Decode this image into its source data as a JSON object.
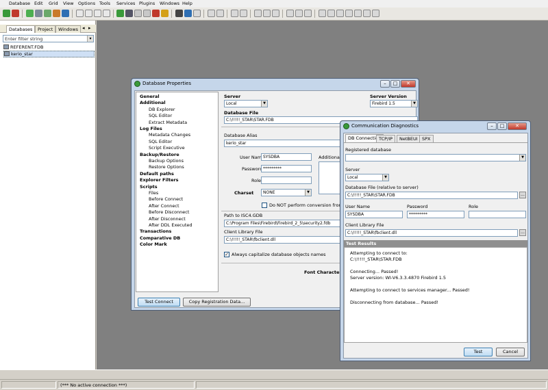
{
  "menu": [
    "Database",
    "Edit",
    "Grid",
    "View",
    "Options",
    "Tools",
    "Services",
    "Plugins",
    "Windows",
    "Help"
  ],
  "left_panel": {
    "tabs": [
      "Databases",
      "Project",
      "Windows"
    ],
    "filter_placeholder": "Enter filter string",
    "tree": [
      "REFERENT.FDB",
      "kerio_star"
    ]
  },
  "status": {
    "connection": "(*** No active connection ***)"
  },
  "db_props": {
    "title": "Database Properties",
    "nav": [
      {
        "label": "General",
        "bold": true,
        "indent": 0
      },
      {
        "label": "Additional",
        "bold": true,
        "indent": 0
      },
      {
        "label": "DB Explorer",
        "bold": false,
        "indent": 1
      },
      {
        "label": "SQL Editor",
        "bold": false,
        "indent": 1
      },
      {
        "label": "Extract Metadata",
        "bold": false,
        "indent": 1
      },
      {
        "label": "Log Files",
        "bold": true,
        "indent": 0
      },
      {
        "label": "Metadata Changes",
        "bold": false,
        "indent": 1
      },
      {
        "label": "SQL Editor",
        "bold": false,
        "indent": 1
      },
      {
        "label": "Script Executive",
        "bold": false,
        "indent": 1
      },
      {
        "label": "Backup/Restore",
        "bold": true,
        "indent": 0
      },
      {
        "label": "Backup Options",
        "bold": false,
        "indent": 1
      },
      {
        "label": "Restore Options",
        "bold": false,
        "indent": 1
      },
      {
        "label": "Default paths",
        "bold": true,
        "indent": 0
      },
      {
        "label": "Explorer Filters",
        "bold": true,
        "indent": 0
      },
      {
        "label": "Scripts",
        "bold": true,
        "indent": 0
      },
      {
        "label": "Files",
        "bold": false,
        "indent": 1
      },
      {
        "label": "Before Connect",
        "bold": false,
        "indent": 1
      },
      {
        "label": "After Connect",
        "bold": false,
        "indent": 1
      },
      {
        "label": "Before Disconnect",
        "bold": false,
        "indent": 1
      },
      {
        "label": "After Disconnect",
        "bold": false,
        "indent": 1
      },
      {
        "label": "After DDL Executed",
        "bold": false,
        "indent": 1
      },
      {
        "label": "Transactions",
        "bold": true,
        "indent": 0
      },
      {
        "label": "Comparative DB",
        "bold": true,
        "indent": 0
      },
      {
        "label": "Color Mark",
        "bold": true,
        "indent": 0
      }
    ],
    "server_label": "Server",
    "server_value": "Local",
    "server_version_label": "Server Version",
    "server_version_value": "Firebird 1.5",
    "db_file_label": "Database File",
    "db_file_value": "C:\\!!!!!_STAR\\STAR.FDB",
    "alias_label": "Database Alias",
    "alias_value": "kerio_star",
    "user_label": "User Name",
    "user_value": "SYSDBA",
    "password_label": "Password",
    "password_value": "*********",
    "role_label": "Role",
    "role_value": "",
    "additional_label": "Additional c",
    "charset_label": "Charset",
    "charset_value": "NONE",
    "noconv_label": "Do NOT perform conversion from/to U",
    "isc4_label": "Path to ISC4.GDB",
    "isc4_value": "C:\\Program Files\\Firebird\\Firebird_2_5\\security2.fdb",
    "client_lib_label": "Client Library File",
    "client_lib_value": "C:\\!!!!!_STAR\\fbclient.dll",
    "capitalize_label": "Always capitalize database objects names",
    "font_chars_label": "Font Characters",
    "test_connect": "Test Connect",
    "copy_reg": "Copy Registration Data..."
  },
  "comm_diag": {
    "title": "Communication Diagnostics",
    "tabs": [
      "DB Connection",
      "TCP/IP",
      "NetBEUI",
      "SPX"
    ],
    "registered_label": "Registered database",
    "registered_value": "",
    "server_label": "Server",
    "server_value": "Local",
    "db_file_label": "Database File (relative to server)",
    "db_file_value": "C:\\!!!!!_STAR\\STAR.FDB",
    "user_label": "User Name",
    "user_value": "SYSDBA",
    "password_label": "Password",
    "password_value": "*********",
    "role_label": "Role",
    "role_value": "",
    "client_lib_label": "Client Library File",
    "client_lib_value": "C:\\!!!!!_STAR\\fbclient.dll",
    "results_header": "Test Results",
    "results": [
      "Attempting to connect to:",
      "C:\\!!!!!_STAR\\STAR.FDB",
      "",
      "Connecting... Passed!",
      "Server version: WI-V6.3.3.4870 Firebird 1.5",
      "",
      "Attempting to connect to services manager... Passed!",
      "",
      "Disconnecting from database... Passed!"
    ],
    "test_btn": "Test",
    "cancel_btn": "Cancel"
  }
}
